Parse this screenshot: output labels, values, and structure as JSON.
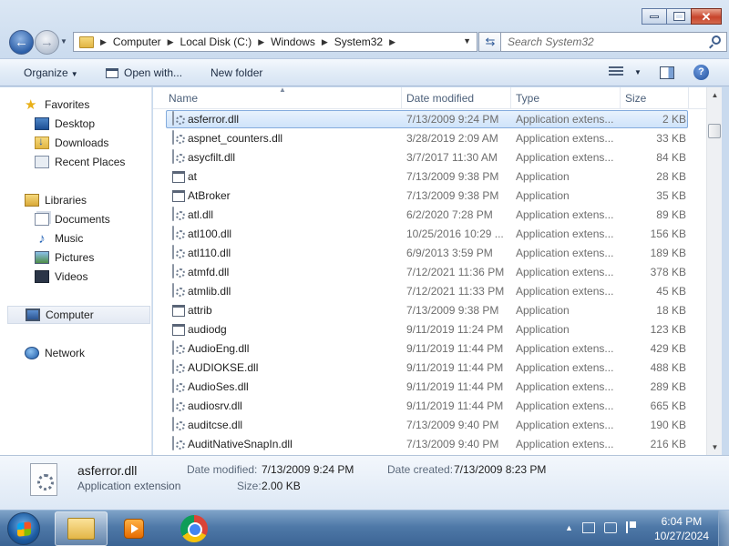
{
  "window": {
    "address": {
      "crumbs": [
        "Computer",
        "Local Disk (C:)",
        "Windows",
        "System32"
      ]
    },
    "search_placeholder": "Search System32"
  },
  "toolbar": {
    "organize": "Organize",
    "open_with": "Open with...",
    "new_folder": "New folder"
  },
  "sidebar": {
    "favorites": {
      "label": "Favorites",
      "items": [
        {
          "label": "Desktop",
          "icon": "desktop-icon"
        },
        {
          "label": "Downloads",
          "icon": "downloads-icon"
        },
        {
          "label": "Recent Places",
          "icon": "recent-places-icon"
        }
      ]
    },
    "libraries": {
      "label": "Libraries",
      "items": [
        {
          "label": "Documents",
          "icon": "documents-icon"
        },
        {
          "label": "Music",
          "icon": "music-icon"
        },
        {
          "label": "Pictures",
          "icon": "pictures-icon"
        },
        {
          "label": "Videos",
          "icon": "videos-icon"
        }
      ]
    },
    "computer": "Computer",
    "network": "Network"
  },
  "columns": {
    "name": "Name",
    "date": "Date modified",
    "type": "Type",
    "size": "Size"
  },
  "files": [
    {
      "name": "asferror.dll",
      "date": "7/13/2009 9:24 PM",
      "type": "Application extens...",
      "size": "2 KB",
      "kind": "dll",
      "selected": true
    },
    {
      "name": "aspnet_counters.dll",
      "date": "3/28/2019 2:09 AM",
      "type": "Application extens...",
      "size": "33 KB",
      "kind": "dll"
    },
    {
      "name": "asycfilt.dll",
      "date": "3/7/2017 11:30 AM",
      "type": "Application extens...",
      "size": "84 KB",
      "kind": "dll"
    },
    {
      "name": "at",
      "date": "7/13/2009 9:38 PM",
      "type": "Application",
      "size": "28 KB",
      "kind": "app"
    },
    {
      "name": "AtBroker",
      "date": "7/13/2009 9:38 PM",
      "type": "Application",
      "size": "35 KB",
      "kind": "app"
    },
    {
      "name": "atl.dll",
      "date": "6/2/2020 7:28 PM",
      "type": "Application extens...",
      "size": "89 KB",
      "kind": "dll"
    },
    {
      "name": "atl100.dll",
      "date": "10/25/2016 10:29 ...",
      "type": "Application extens...",
      "size": "156 KB",
      "kind": "dll"
    },
    {
      "name": "atl110.dll",
      "date": "6/9/2013 3:59 PM",
      "type": "Application extens...",
      "size": "189 KB",
      "kind": "dll"
    },
    {
      "name": "atmfd.dll",
      "date": "7/12/2021 11:36 PM",
      "type": "Application extens...",
      "size": "378 KB",
      "kind": "dll"
    },
    {
      "name": "atmlib.dll",
      "date": "7/12/2021 11:33 PM",
      "type": "Application extens...",
      "size": "45 KB",
      "kind": "dll"
    },
    {
      "name": "attrib",
      "date": "7/13/2009 9:38 PM",
      "type": "Application",
      "size": "18 KB",
      "kind": "app"
    },
    {
      "name": "audiodg",
      "date": "9/11/2019 11:24 PM",
      "type": "Application",
      "size": "123 KB",
      "kind": "app"
    },
    {
      "name": "AudioEng.dll",
      "date": "9/11/2019 11:44 PM",
      "type": "Application extens...",
      "size": "429 KB",
      "kind": "dll"
    },
    {
      "name": "AUDIOKSE.dll",
      "date": "9/11/2019 11:44 PM",
      "type": "Application extens...",
      "size": "488 KB",
      "kind": "dll"
    },
    {
      "name": "AudioSes.dll",
      "date": "9/11/2019 11:44 PM",
      "type": "Application extens...",
      "size": "289 KB",
      "kind": "dll"
    },
    {
      "name": "audiosrv.dll",
      "date": "9/11/2019 11:44 PM",
      "type": "Application extens...",
      "size": "665 KB",
      "kind": "dll"
    },
    {
      "name": "auditcse.dll",
      "date": "7/13/2009 9:40 PM",
      "type": "Application extens...",
      "size": "190 KB",
      "kind": "dll"
    },
    {
      "name": "AuditNativeSnapIn.dll",
      "date": "7/13/2009 9:40 PM",
      "type": "Application extens...",
      "size": "216 KB",
      "kind": "dll"
    }
  ],
  "details": {
    "name": "asferror.dll",
    "type": "Application extension",
    "modified_label": "Date modified:",
    "modified_value": "7/13/2009 9:24 PM",
    "created_label": "Date created:",
    "created_value": "7/13/2009 8:23 PM",
    "size_label": "Size:",
    "size_value": "2.00 KB"
  },
  "taskbar": {
    "time": "6:04 PM",
    "date": "10/27/2024",
    "apps": [
      "windows-explorer",
      "media-player",
      "google-chrome"
    ]
  }
}
